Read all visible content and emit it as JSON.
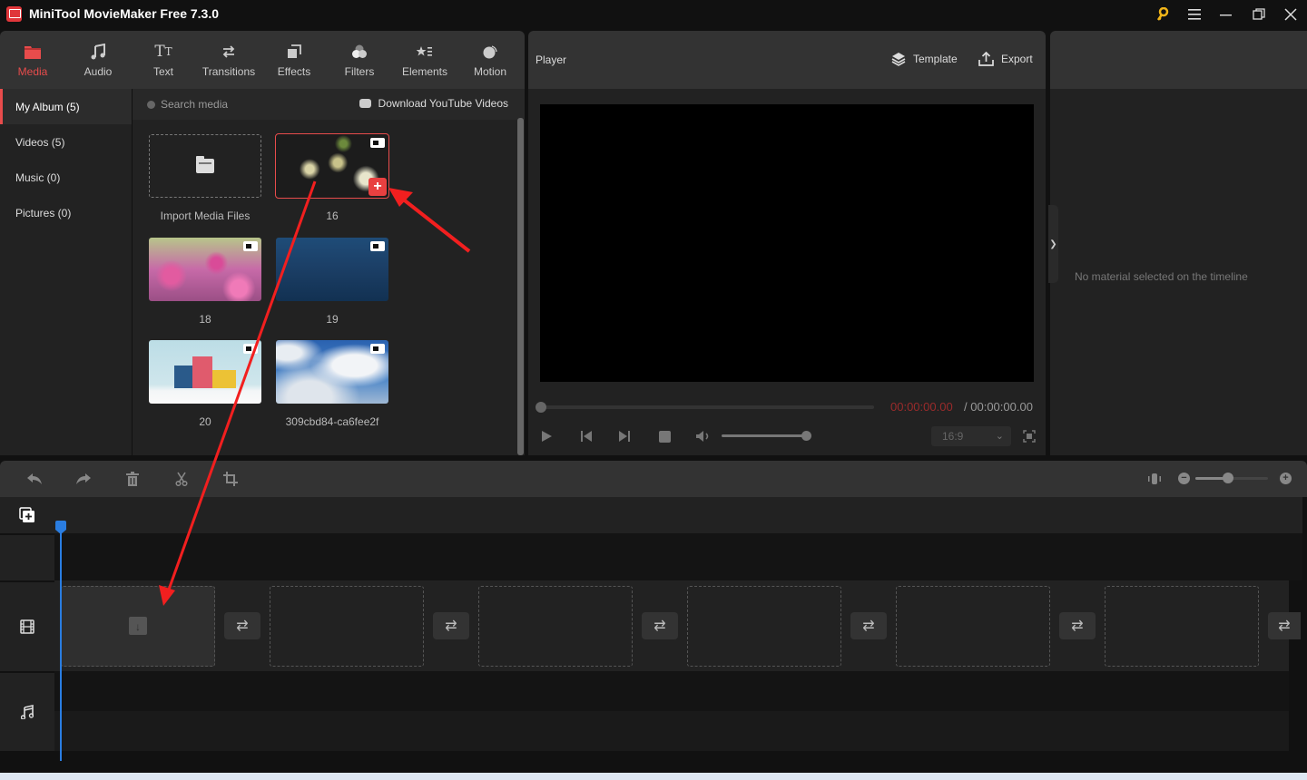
{
  "window": {
    "title": "MiniTool MovieMaker Free 7.3.0",
    "controls": [
      "key-icon",
      "menu-icon",
      "minimize-icon",
      "maximize-icon",
      "close-icon"
    ],
    "key_color": "#f0b419"
  },
  "top_tabs": [
    {
      "label": "Media",
      "icon": "folder-icon",
      "active": true
    },
    {
      "label": "Audio",
      "icon": "music-icon",
      "active": false
    },
    {
      "label": "Text",
      "icon": "text-icon",
      "active": false
    },
    {
      "label": "Transitions",
      "icon": "transitions-icon",
      "active": false
    },
    {
      "label": "Effects",
      "icon": "effects-icon",
      "active": false
    },
    {
      "label": "Filters",
      "icon": "filters-icon",
      "active": false
    },
    {
      "label": "Elements",
      "icon": "elements-icon",
      "active": false
    },
    {
      "label": "Motion",
      "icon": "motion-icon",
      "active": false
    }
  ],
  "accent_color": "#e84c4c",
  "sidebar": {
    "items": [
      {
        "label": "My Album (5)",
        "active": true
      },
      {
        "label": "Videos (5)",
        "active": false
      },
      {
        "label": "Music (0)",
        "active": false
      },
      {
        "label": "Pictures (0)",
        "active": false
      }
    ]
  },
  "media": {
    "search_placeholder": "Search media",
    "download_label": "Download YouTube Videos",
    "import_label": "Import Media Files",
    "items": [
      {
        "label": "16",
        "type": "video",
        "selected": true,
        "thumb": "white blossoms on dark background"
      },
      {
        "label": "18",
        "type": "video",
        "selected": false,
        "thumb": "pink cosmos flower field"
      },
      {
        "label": "19",
        "type": "video",
        "selected": false,
        "thumb": "blue sea water surface"
      },
      {
        "label": "20",
        "type": "video",
        "selected": false,
        "thumb": "illustrated snowy houses"
      },
      {
        "label": "309cbd84-ca6fee2f",
        "type": "video",
        "selected": false,
        "thumb": "blue sky with clouds"
      }
    ]
  },
  "player": {
    "title": "Player",
    "template_label": "Template",
    "export_label": "Export",
    "current_time": "00:00:00.00",
    "separator": "/",
    "total_time": "00:00:00.00",
    "aspect_ratio": "16:9",
    "progress": 0,
    "volume": 1.0
  },
  "properties": {
    "empty_message": "No material selected on the timeline"
  },
  "timeline": {
    "tools": [
      "undo-icon",
      "redo-icon",
      "delete-icon",
      "split-icon",
      "crop-icon"
    ],
    "zoom_level": 0.45,
    "playhead_color": "#2a7de1",
    "video_track_slots": 6,
    "transition_slots": 6
  }
}
